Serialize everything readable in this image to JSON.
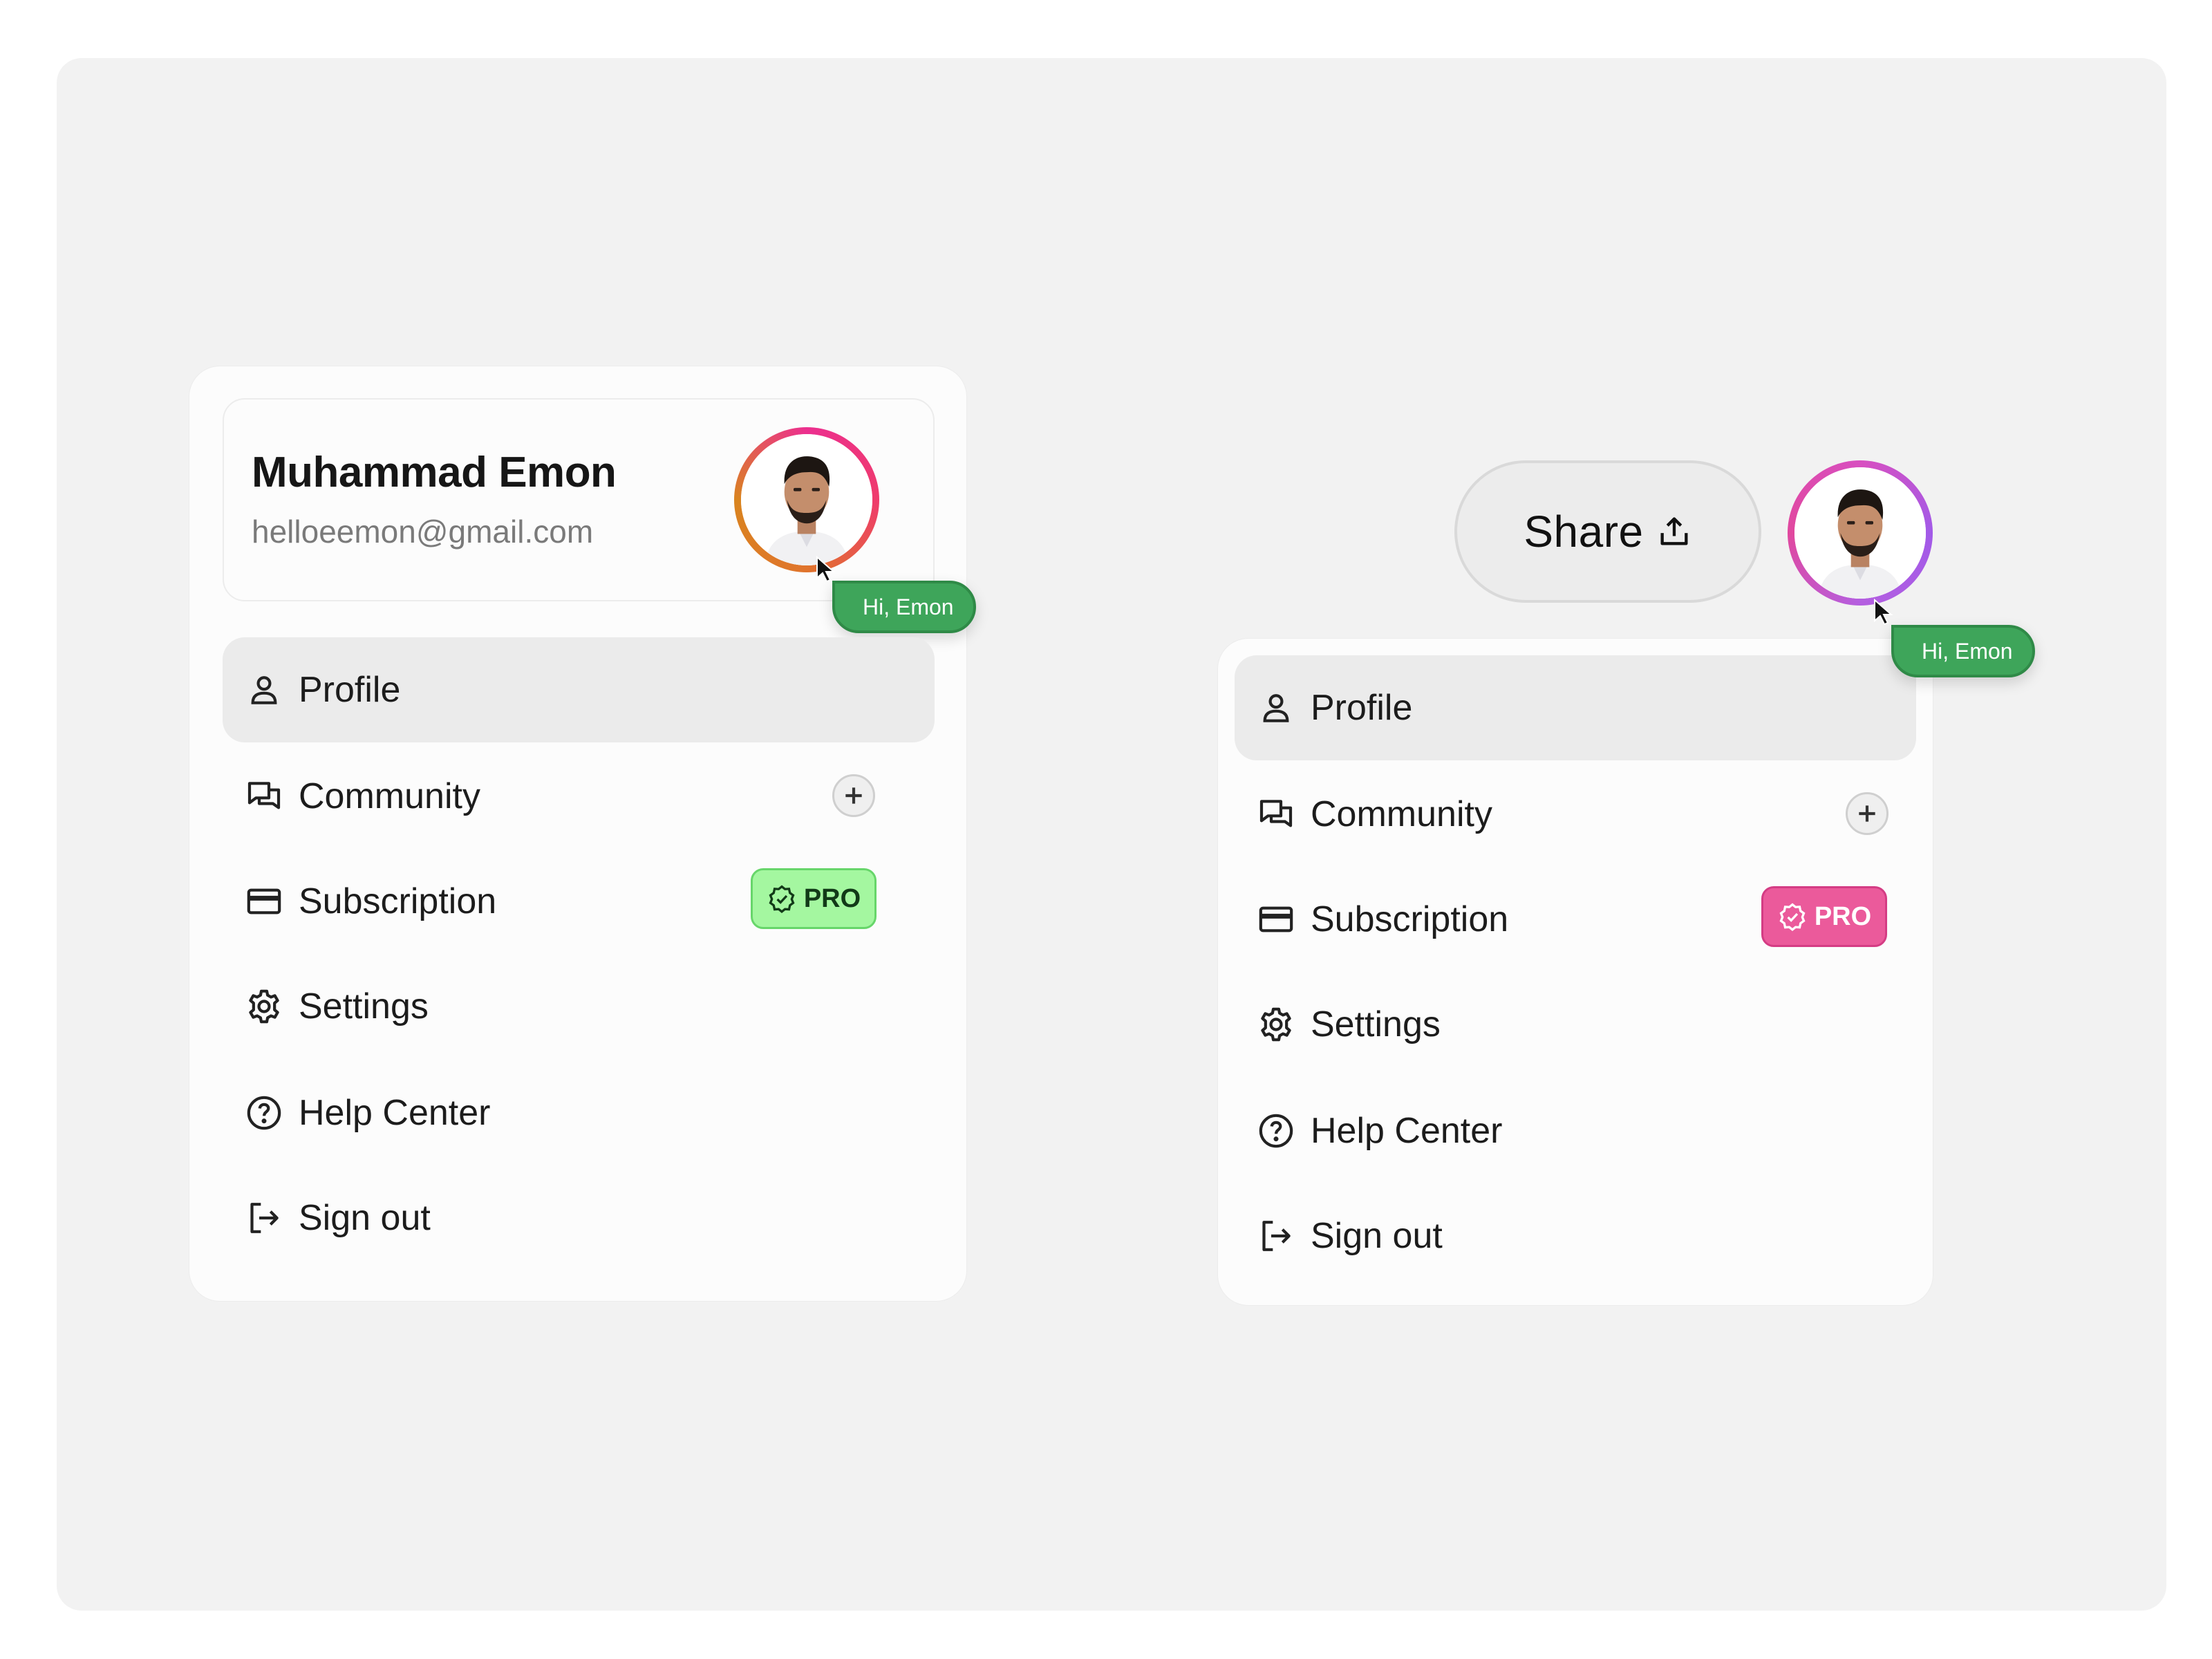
{
  "user": {
    "name": "Muhammad Emon",
    "email": "helloeemon@gmail.com"
  },
  "tooltip": {
    "greeting": "Hi, Emon"
  },
  "share": {
    "label": "Share"
  },
  "menu": {
    "items": [
      {
        "label": "Profile",
        "icon": "user-icon"
      },
      {
        "label": "Community",
        "icon": "chat-icon"
      },
      {
        "label": "Subscription",
        "icon": "credit-card-icon"
      },
      {
        "label": "Settings",
        "icon": "gear-icon"
      },
      {
        "label": "Help Center",
        "icon": "help-circle-icon"
      },
      {
        "label": "Sign out",
        "icon": "sign-out-icon"
      }
    ],
    "active_item": "Profile"
  },
  "badges": {
    "pro_label": "PRO",
    "variants": [
      {
        "variant": "left",
        "background": "#a4f7a0",
        "text_color": "#123a18"
      },
      {
        "variant": "right",
        "background": "#eb5a9b",
        "text_color": "#ffffff"
      }
    ]
  },
  "colors": {
    "tooltip_bg": "#3ea55a",
    "active_item_bg": "#ebebeb",
    "canvas_bg": "#f2f2f2",
    "avatar_ring_left": "#ec2f8f",
    "avatar_ring_right": "#a25ae8"
  }
}
